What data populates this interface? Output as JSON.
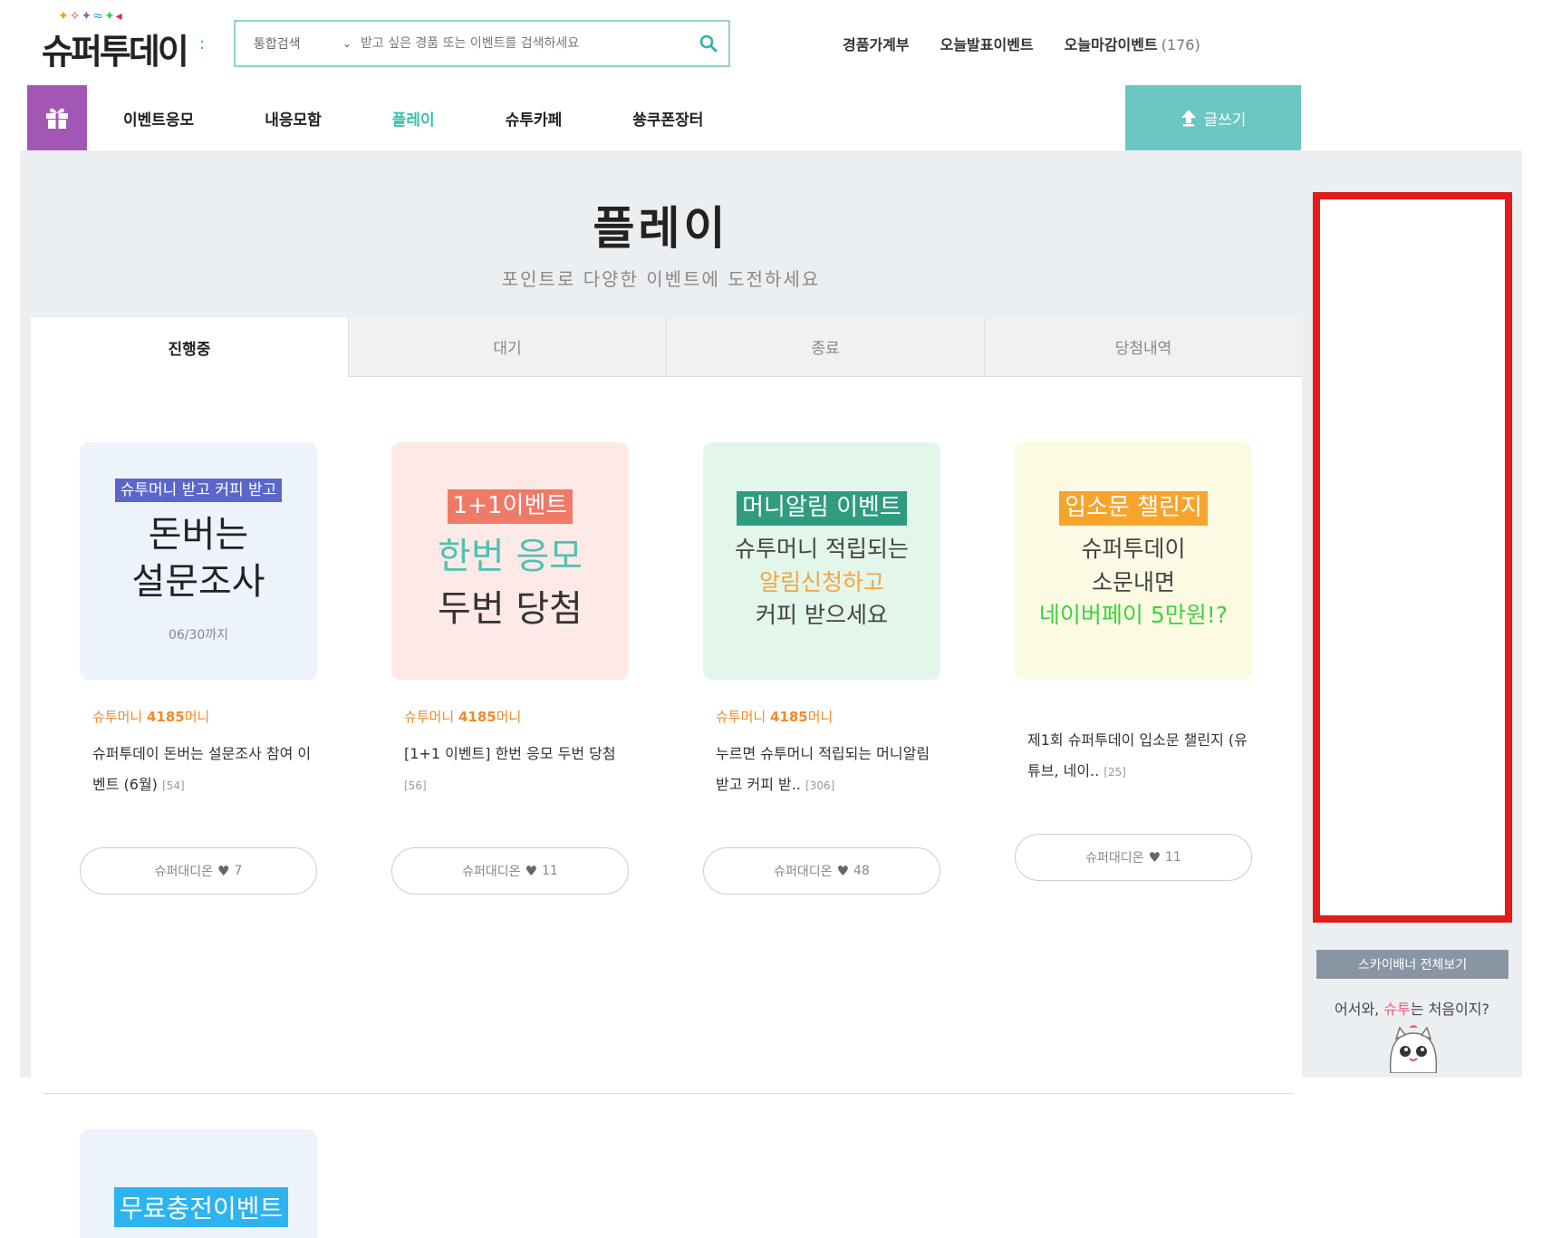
{
  "header": {
    "logo_text": "슈퍼투데이",
    "search": {
      "scope": "통합검색",
      "placeholder": "받고 싶은 경품 또는 이벤트를 검색하세요"
    },
    "links": [
      {
        "label": "경품가계부"
      },
      {
        "label": "오늘발표이벤트"
      },
      {
        "label": "오늘마감이벤트",
        "count": "(176)"
      }
    ]
  },
  "nav": {
    "items": [
      "이벤트응모",
      "내응모함",
      "플레이",
      "슈투카페",
      "쑝쿠폰장터"
    ],
    "active": "플레이",
    "write_label": "글쓰기"
  },
  "hero": {
    "title": "플레이",
    "subtitle": "포인트로 다양한 이벤트에 도전하세요"
  },
  "tabs": [
    "진행중",
    "대기",
    "종료",
    "당첨내역"
  ],
  "cards": [
    {
      "thumb_tag": "슈투머니 받고 커피 받고",
      "thumb_line1": "돈버는",
      "thumb_line2": "설문조사",
      "thumb_date": "06/30까지",
      "meta_prefix": "슈투머니",
      "meta_amount": "4185",
      "meta_suffix": "머니",
      "title": "슈퍼투데이 돈버는 설문조사 참여 이벤트 (6월)",
      "count": "[54]",
      "cheer_label": "슈퍼대디온",
      "cheer_count": "7"
    },
    {
      "thumb_tag": "1+1이벤트",
      "thumb_line1": "한번 응모",
      "thumb_line2": "두번 당첨",
      "meta_prefix": "슈투머니",
      "meta_amount": "4185",
      "meta_suffix": "머니",
      "title": "[1+1 이벤트] 한번 응모 두번 당첨",
      "count": "[56]",
      "cheer_label": "슈퍼대디온",
      "cheer_count": "11"
    },
    {
      "thumb_tag": "머니알림 이벤트",
      "thumb_line1": "슈투머니 적립되는",
      "thumb_line2": "알림신청하고",
      "thumb_line3": "커피 받으세요",
      "meta_prefix": "슈투머니",
      "meta_amount": "4185",
      "meta_suffix": "머니",
      "title": "누르면 슈투머니 적립되는 머니알림 받고 커피 받..",
      "count": "[306]",
      "cheer_label": "슈퍼대디온",
      "cheer_count": "48"
    },
    {
      "thumb_tag": "입소문 챌린지",
      "thumb_line1": "슈퍼투데이",
      "thumb_line2": "소문내면",
      "thumb_line3": "네이버페이 5만원!?",
      "title": "제1회 슈퍼투데이 입소문 챌린지 (유튜브, 네이..",
      "count": "[25]",
      "cheer_label": "슈퍼대디온",
      "cheer_count": "11"
    }
  ],
  "next_card": {
    "thumb_tag": "무료충전이벤트"
  },
  "sidebar": {
    "skybanner_label": "스카이배너 전체보기",
    "welcome_prefix": "어서와,",
    "welcome_highlight": "슈투",
    "welcome_suffix": "는 처음이지?"
  },
  "colors": {
    "accent_teal": "#3bbdb1",
    "write_button": "#6cc6c2",
    "gift_purple": "#a357b5",
    "ad_border": "#e21b1b",
    "meta_orange": "#f08b2c"
  }
}
